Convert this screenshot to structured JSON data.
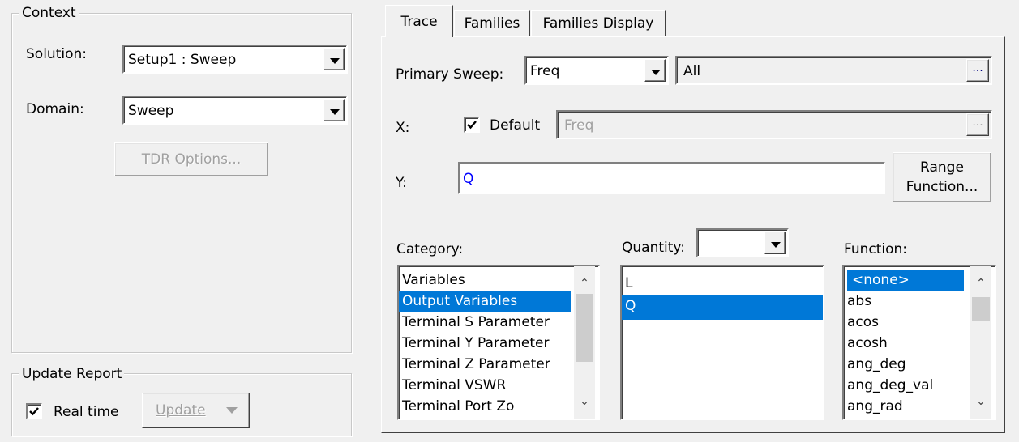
{
  "context": {
    "legend": "Context",
    "solution_label": "Solution:",
    "solution_value": "Setup1 : Sweep",
    "domain_label": "Domain:",
    "domain_value": "Sweep",
    "tdr_button": "TDR Options..."
  },
  "update_report": {
    "legend": "Update Report",
    "realtime_label": "Real time",
    "realtime_checked": true,
    "update_button": "Update"
  },
  "tabs": [
    {
      "label": "Trace",
      "active": true
    },
    {
      "label": "Families",
      "active": false
    },
    {
      "label": "Families Display",
      "active": false
    }
  ],
  "trace": {
    "primary_sweep_label": "Primary Sweep:",
    "primary_sweep_value": "Freq",
    "primary_sweep_range": "All",
    "ellipsis": "...",
    "x_label": "X:",
    "default_label": "Default",
    "default_checked": true,
    "x_value": "Freq",
    "y_label": "Y:",
    "y_value": "Q",
    "range_function_line1": "Range",
    "range_function_line2": "Function...",
    "category_label": "Category:",
    "quantity_label": "Quantity:",
    "quantity_filter": "",
    "function_label": "Function:",
    "categories": [
      "Variables",
      "Output Variables",
      "Terminal S Parameter",
      "Terminal Y Parameter",
      "Terminal Z Parameter",
      "Terminal VSWR",
      "Terminal Port Zo"
    ],
    "category_selected": "Output Variables",
    "quantities": [
      "L",
      "Q"
    ],
    "quantity_selected": "Q",
    "functions": [
      "<none>",
      "abs",
      "acos",
      "acosh",
      "ang_deg",
      "ang_deg_val",
      "ang_rad"
    ],
    "function_selected": "<none>"
  },
  "colors": {
    "selection": "#0078d7",
    "y_text": "#0000ff"
  }
}
